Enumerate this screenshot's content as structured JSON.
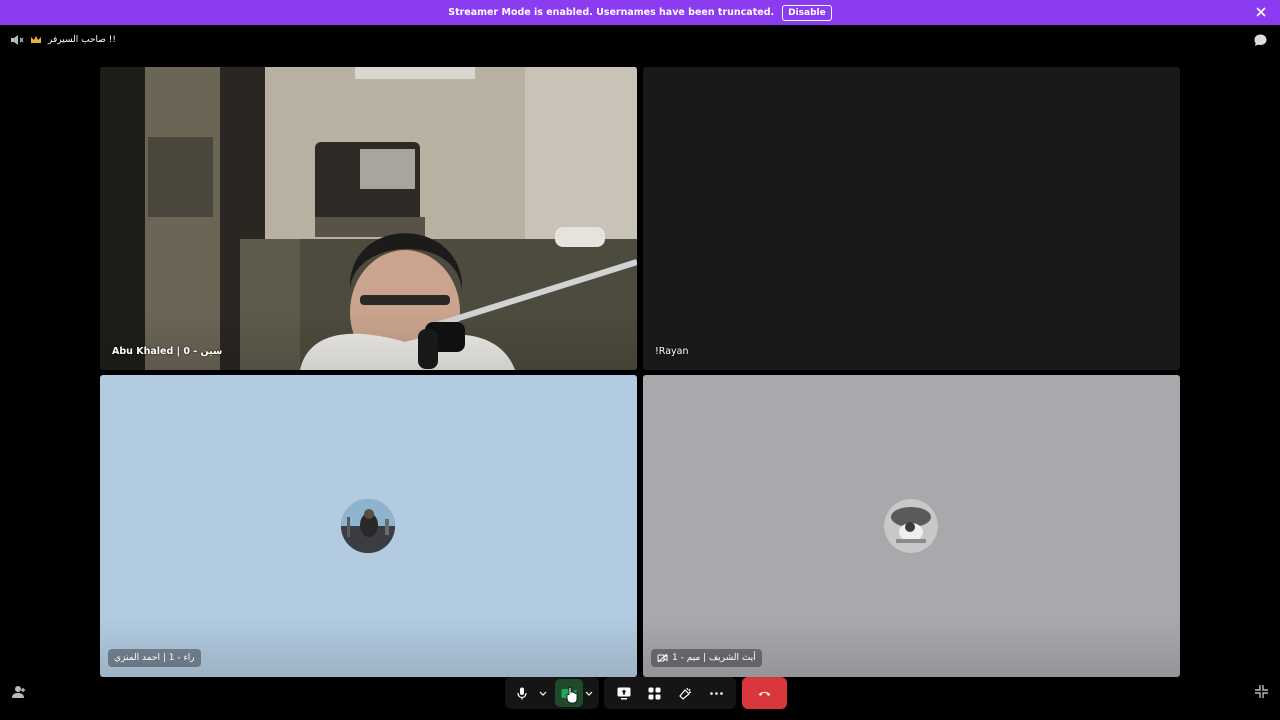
{
  "banner": {
    "message": "Streamer Mode is enabled. Usernames have been truncated.",
    "disable_label": "Disable"
  },
  "channel": {
    "name": "صاحب السيرفر !!",
    "icons": [
      "speaker-muted-icon",
      "crown-icon"
    ]
  },
  "tiles": [
    {
      "name": "Abu Khaled | 0 - سين",
      "video": true
    },
    {
      "name": "!Rayan",
      "video": false,
      "empty": true
    },
    {
      "name": "راء - 1 | احمد المنزي",
      "avatar": true
    },
    {
      "name": "أيث الشريف | ميم - 1",
      "avatar": true,
      "status_icon": "video-off-icon"
    }
  ],
  "controls": {
    "buttons": [
      "microphone-icon",
      "camera-icon",
      "screen-share-icon",
      "activities-icon",
      "soundboard-icon",
      "more-icon",
      "hang-up-icon"
    ],
    "camera_active_color": "#23a55a",
    "hangup_color": "#da373c"
  },
  "colors": {
    "banner": "#8c3cf0"
  }
}
